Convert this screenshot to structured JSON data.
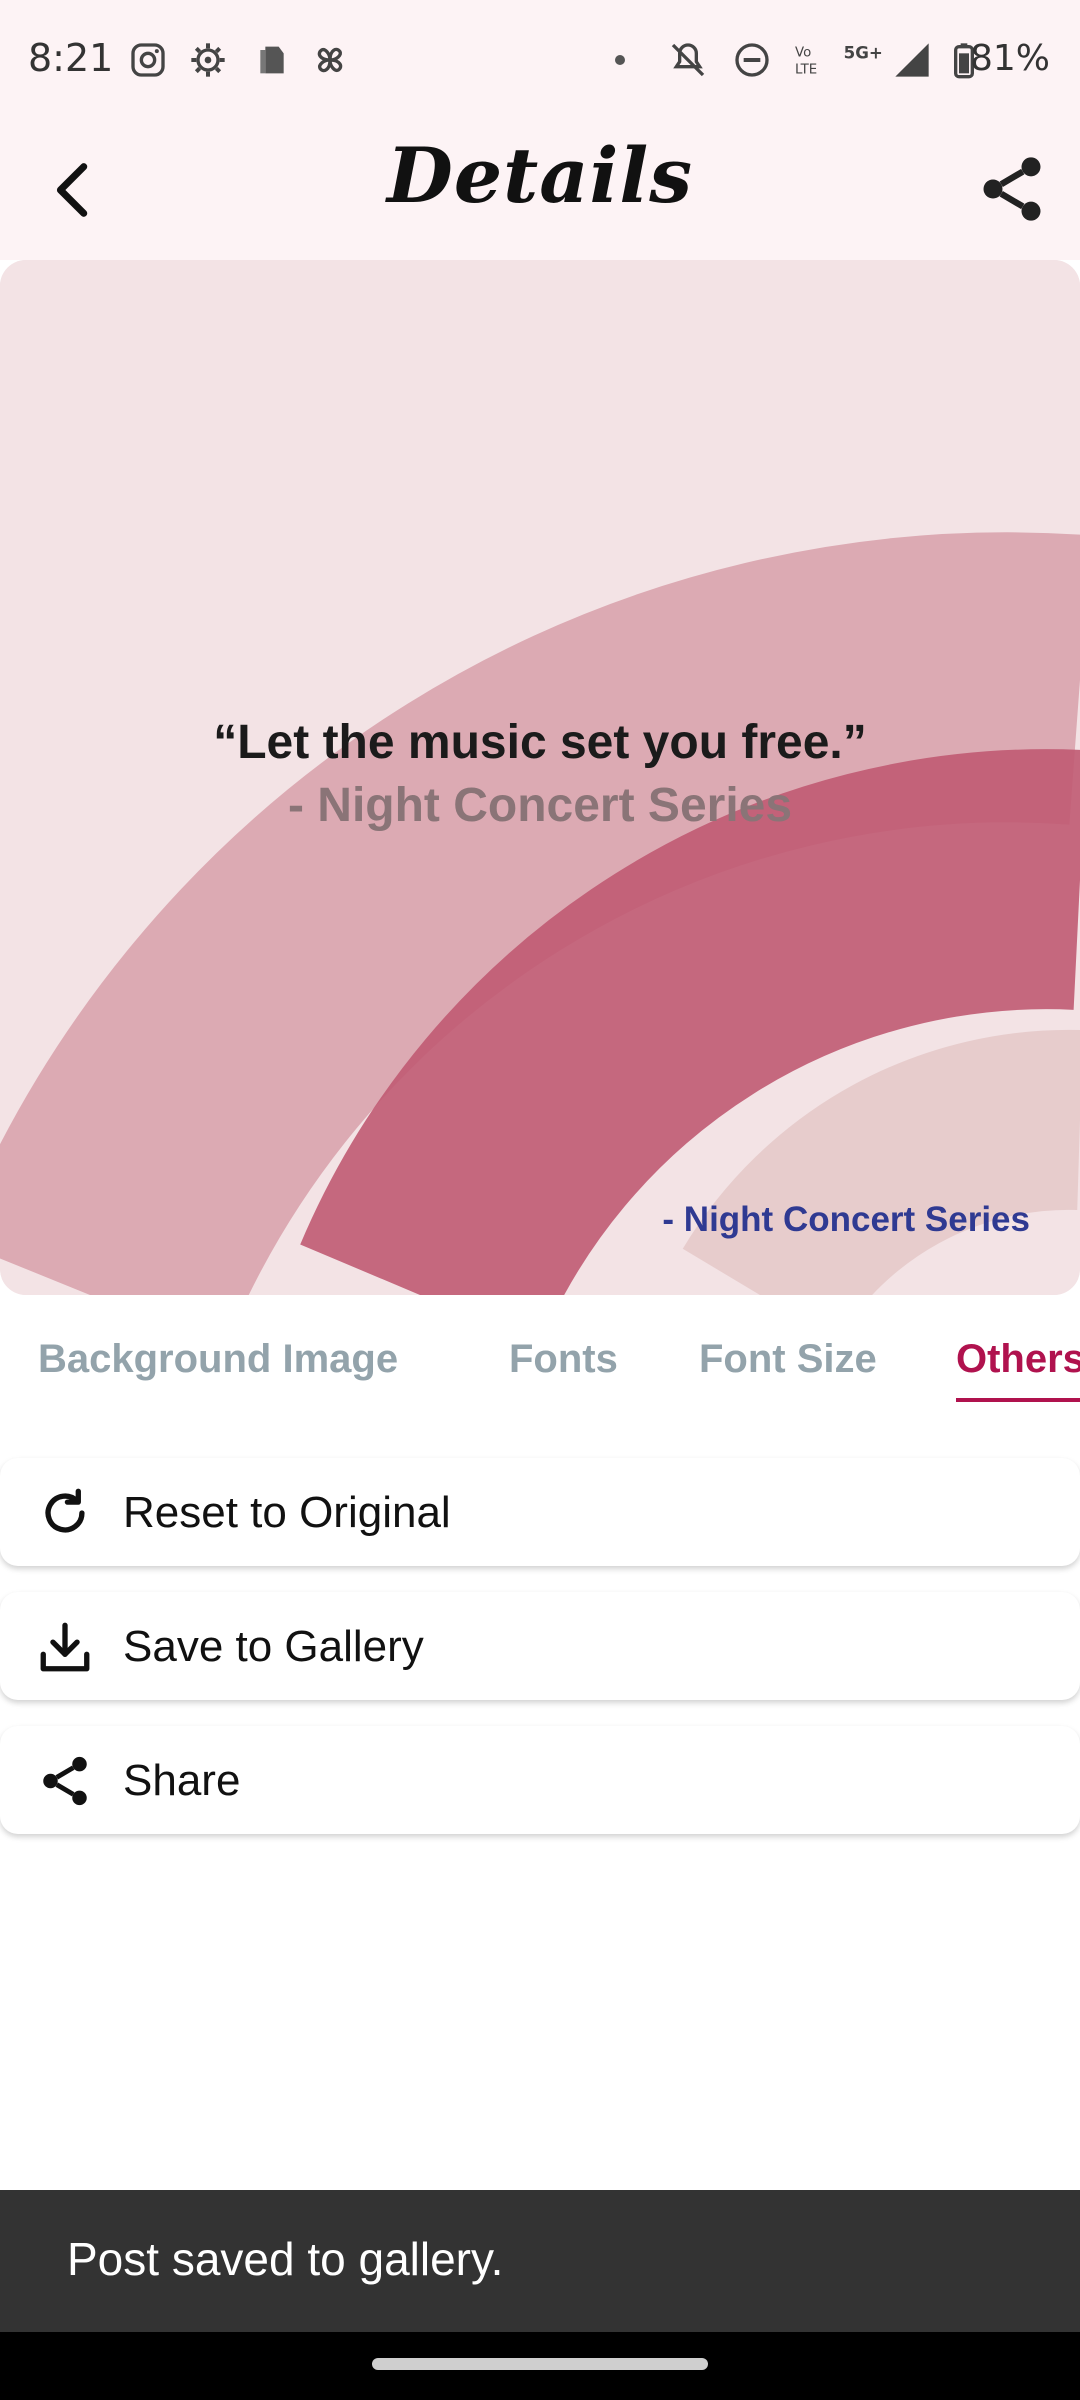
{
  "status_bar": {
    "time": "8:21",
    "battery": "81%",
    "icons": [
      "instagram-icon",
      "settings-gear-icon",
      "app-icon",
      "pinwheel-icon",
      "dot-icon",
      "mute-icon",
      "dnd-icon",
      "volte-icon",
      "5g-icon",
      "signal-icon",
      "battery-icon"
    ]
  },
  "app_bar": {
    "title": "Details"
  },
  "preview": {
    "quote": "“Let the music set you free.”",
    "quote_author": "- Night Concert Series",
    "watermark_author": "- Night Concert Series"
  },
  "tabs": [
    {
      "label": "Background Image",
      "active": false
    },
    {
      "label": "Fonts",
      "active": false
    },
    {
      "label": "Font Size",
      "active": false
    },
    {
      "label": "Others",
      "active": true
    }
  ],
  "actions": [
    {
      "label": "Reset to Original",
      "icon": "refresh-icon"
    },
    {
      "label": "Save to Gallery",
      "icon": "download-icon"
    },
    {
      "label": "Share",
      "icon": "share-icon"
    }
  ],
  "snackbar": {
    "message": "Post saved to gallery."
  },
  "colors": {
    "accent": "#b0124e",
    "tab_inactive": "#93a3ab",
    "watermark": "#2f3a92",
    "snackbar_bg": "#333333"
  }
}
